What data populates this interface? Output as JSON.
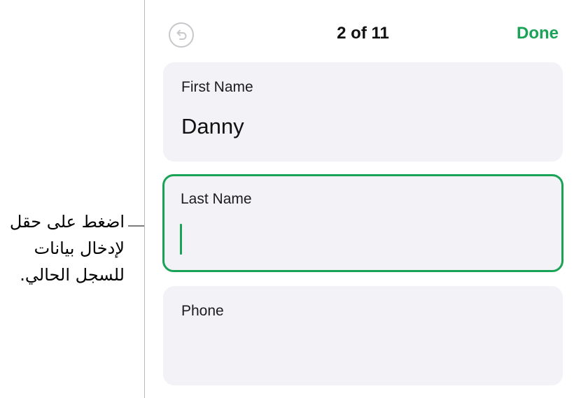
{
  "callout": {
    "text_line1": "اضغط على حقل",
    "text_line2": "لإدخال بيانات",
    "text_line3": "للسجل الحالي."
  },
  "nav": {
    "title": "2 of 11",
    "done_label": "Done",
    "undo_icon": "undo-arrow-icon"
  },
  "fields": [
    {
      "label": "First Name",
      "value": "Danny"
    },
    {
      "label": "Last Name",
      "value": ""
    },
    {
      "label": "Phone",
      "value": ""
    }
  ],
  "colors": {
    "accent": "#1aa356",
    "field_bg": "#f2f2f7",
    "undo_icon": "#c7c7cc"
  }
}
